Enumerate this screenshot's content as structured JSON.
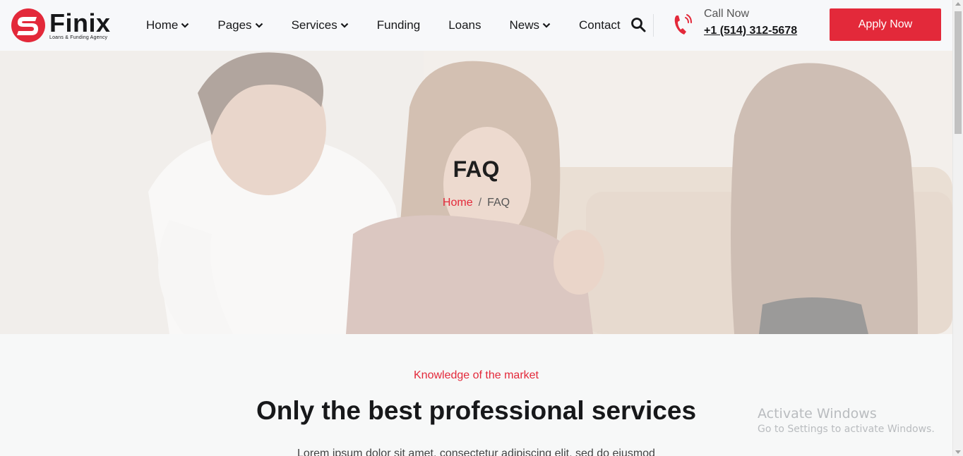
{
  "header": {
    "logo": {
      "name": "Finix",
      "tagline": "Loans & Funding Agency"
    },
    "nav": [
      {
        "label": "Home",
        "dropdown": true
      },
      {
        "label": "Pages",
        "dropdown": true
      },
      {
        "label": "Services",
        "dropdown": true
      },
      {
        "label": "Funding",
        "dropdown": false
      },
      {
        "label": "Loans",
        "dropdown": false
      },
      {
        "label": "News",
        "dropdown": true
      },
      {
        "label": "Contact",
        "dropdown": false
      }
    ],
    "search_icon": "search-icon",
    "call": {
      "label": "Call Now",
      "number": "+1 (514) 312-5678",
      "icon": "phone-ringing-icon"
    },
    "apply_label": "Apply Now"
  },
  "hero": {
    "title": "FAQ",
    "breadcrumb": {
      "home": "Home",
      "separator": "/",
      "current": "FAQ"
    }
  },
  "section": {
    "kicker": "Knowledge of the market",
    "title": "Only the best professional services",
    "text": "Lorem ipsum dolor sit amet, consectetur adipiscing elit, sed do eiusmod"
  },
  "watermark": {
    "title": "Activate Windows",
    "subtitle": "Go to Settings to activate Windows."
  },
  "colors": {
    "accent": "#e3293a",
    "text": "#17181a",
    "background": "#f7f8f8"
  }
}
